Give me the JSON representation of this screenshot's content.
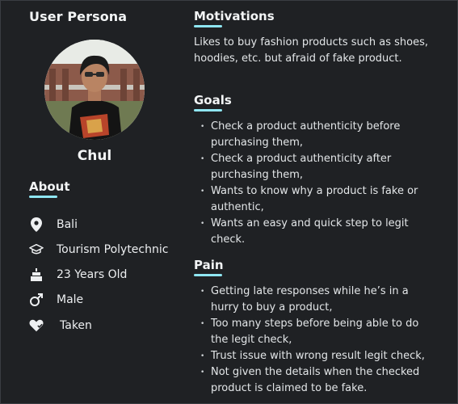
{
  "persona": {
    "title": "User Persona",
    "name": "Chul",
    "avatar_alt": ""
  },
  "about": {
    "heading": "About",
    "items": [
      {
        "icon": "location-pin-icon",
        "label": "Bali"
      },
      {
        "icon": "graduation-cap-icon",
        "label": "Tourism Polytechnic"
      },
      {
        "icon": "cake-icon",
        "label": "23 Years Old"
      },
      {
        "icon": "male-symbol-icon",
        "label": "Male"
      },
      {
        "icon": "heart-icon",
        "label": "Taken"
      }
    ]
  },
  "motivations": {
    "heading": "Motivations",
    "text": "Likes to buy fashion products such as shoes, hoodies, etc. but afraid of fake product."
  },
  "goals": {
    "heading": "Goals",
    "items": [
      "Check a product authenticity before purchasing them,",
      "Check a product authenticity after purchasing them,",
      "Wants to know why a product is fake or authentic,",
      "Wants an easy and quick step to legit check."
    ]
  },
  "pain": {
    "heading": "Pain",
    "items": [
      "Getting late responses while he’s in a hurry to buy a product,",
      "Too many steps before being able to do the legit check,",
      "Trust issue with wrong result legit check,",
      "Not given the details when the checked product is claimed to be fake."
    ]
  },
  "colors": {
    "background": "#1f2124",
    "accent": "#8fe6f2",
    "text": "#e9ecee"
  }
}
